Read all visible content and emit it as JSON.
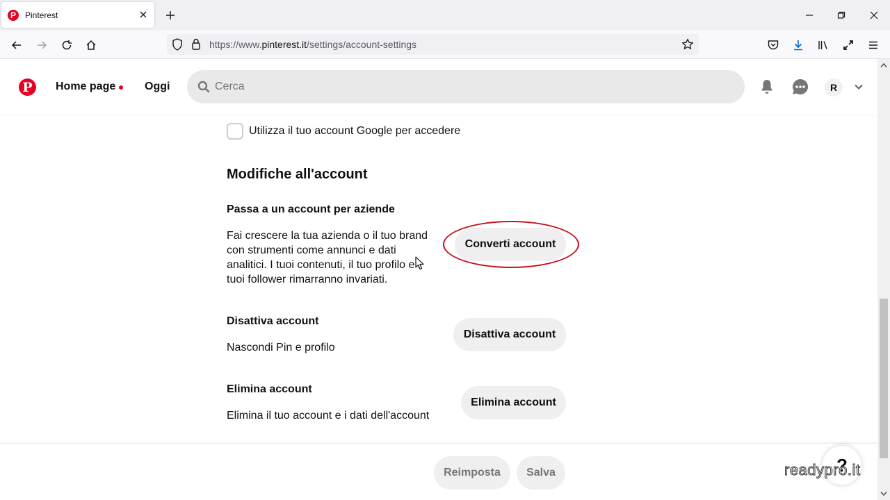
{
  "browser": {
    "tab_title": "Pinterest",
    "tab_favicon": "pinterest-icon",
    "url_prefix": "https://www.",
    "url_host": "pinterest.it",
    "url_path": "/settings/account-settings"
  },
  "header": {
    "logo": "P",
    "home_label": "Home page",
    "today_label": "Oggi",
    "search_placeholder": "Cerca",
    "avatar_letter": "R"
  },
  "content": {
    "google_checkbox_label": "Utilizza il tuo account Google per accedere",
    "google_checkbox_checked": false,
    "section_title": "Modifiche all'account",
    "business": {
      "title": "Passa a un account per aziende",
      "desc_lines": [
        "Fai crescere la tua azienda o il tuo brand",
        "con strumenti come annunci e dati",
        "analitici. I tuoi contenuti, il tuo profilo e i",
        "tuoi follower rimarranno invariati."
      ],
      "button": "Converti account"
    },
    "deactivate": {
      "title": "Disattiva account",
      "desc": "Nascondi Pin e profilo",
      "button": "Disattiva account"
    },
    "delete": {
      "title": "Elimina account",
      "desc": "Elimina il tuo account e i dati dell'account",
      "button": "Elimina account"
    }
  },
  "footer": {
    "reset_label": "Reimposta",
    "save_label": "Salva",
    "help_label": "?"
  },
  "watermark": "readypro.it",
  "colors": {
    "brand": "#e60023",
    "annotation": "#c8101e",
    "button_bg": "#efefef"
  }
}
